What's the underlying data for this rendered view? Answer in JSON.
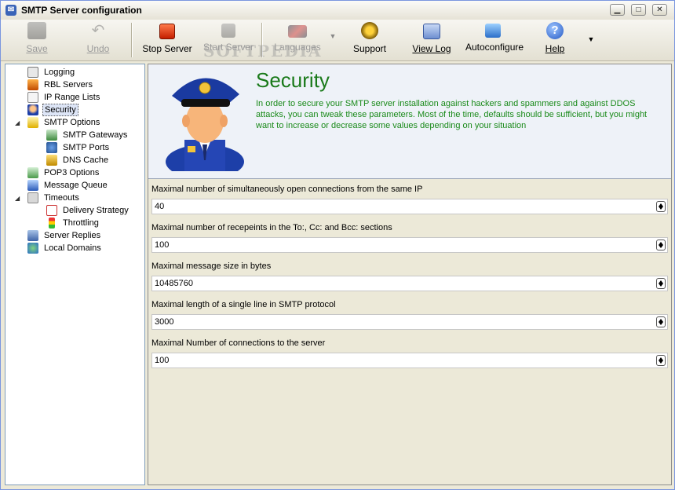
{
  "window": {
    "title": "SMTP Server configuration"
  },
  "toolbar": {
    "save": "Save",
    "undo": "Undo",
    "stop_server": "Stop Server",
    "start_server": "Start Server",
    "languages": "Languages",
    "support": "Support",
    "view_log": "View Log",
    "autoconfigure": "Autoconfigure",
    "help": "Help",
    "watermark": "SOFTPEDIA"
  },
  "tree": {
    "items": [
      {
        "label": "Logging",
        "icon": "log-icon"
      },
      {
        "label": "RBL Servers",
        "icon": "rbl-icon"
      },
      {
        "label": "IP Range Lists",
        "icon": "ip-range-icon"
      },
      {
        "label": "Security",
        "icon": "officer-icon",
        "selected": true
      },
      {
        "label": "SMTP Options",
        "icon": "envelope-icon",
        "expanded": true
      },
      {
        "label": "SMTP Gateways",
        "icon": "gateway-icon"
      },
      {
        "label": "SMTP Ports",
        "icon": "ports-icon"
      },
      {
        "label": "DNS Cache",
        "icon": "cache-icon"
      },
      {
        "label": "POP3 Options",
        "icon": "pop3-icon"
      },
      {
        "label": "Message Queue",
        "icon": "queue-icon"
      },
      {
        "label": "Timeouts",
        "icon": "timeout-icon",
        "expanded": true
      },
      {
        "label": "Delivery Strategy",
        "icon": "calendar-icon"
      },
      {
        "label": "Throttling",
        "icon": "traffic-light-icon"
      },
      {
        "label": "Server Replies",
        "icon": "server-icon"
      },
      {
        "label": "Local Domains",
        "icon": "domains-icon"
      }
    ]
  },
  "security": {
    "title": "Security",
    "description": "In order to secure your SMTP server installation against hackers and spammers and against DDOS attacks, you can tweak these parameters. Most of the time, defaults should be sufficient, but you might want to increase or decrease some values depending on your situation"
  },
  "fields": [
    {
      "label": "Maximal number of simultaneously open connections from the same IP",
      "value": "40"
    },
    {
      "label": "Maximal number of recepeints in the To:, Cc: and Bcc: sections",
      "value": "100"
    },
    {
      "label": "Maximal message size in bytes",
      "value": "10485760"
    },
    {
      "label": "Maximal length of a single line in SMTP protocol",
      "value": "3000"
    },
    {
      "label": "Maximal Number of connections to the server",
      "value": "100"
    }
  ],
  "colors": {
    "accent_green": "#1a7a1a",
    "tree_border": "#7f9db9",
    "selection": "#dde5f6"
  }
}
